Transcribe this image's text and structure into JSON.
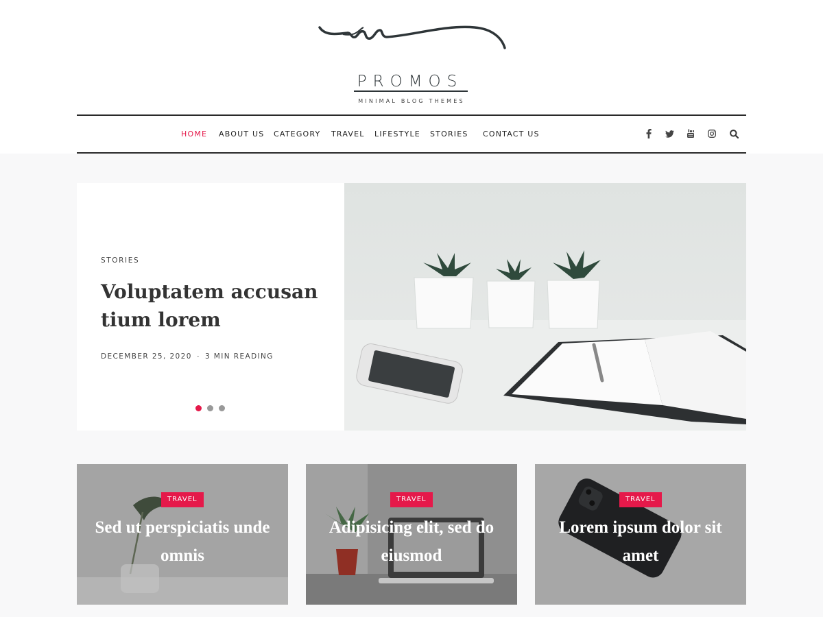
{
  "logo": {
    "wordmark": "PROMOS",
    "tagline": "MINIMAL BLOG THEMES"
  },
  "nav": {
    "items": [
      {
        "label": "HOME",
        "active": true
      },
      {
        "label": "ABOUT US",
        "active": false
      },
      {
        "label": "CATEGORY",
        "active": false
      },
      {
        "label": "TRAVEL",
        "active": false
      },
      {
        "label": "LIFESTYLE",
        "active": false
      },
      {
        "label": "STORIES",
        "active": false
      },
      {
        "label": "CONTACT US",
        "active": false
      }
    ],
    "social_icons": [
      "facebook-icon",
      "twitter-icon",
      "youtube-icon",
      "instagram-icon",
      "search-icon"
    ]
  },
  "hero": {
    "category": "STORIES",
    "title": "Voluptatem accusan tium lorem",
    "date": "DECEMBER 25, 2020",
    "separator": "-",
    "reading": "3 MIN READING",
    "slides": 3,
    "active_slide": 1
  },
  "cards": [
    {
      "category": "TRAVEL",
      "title": "Sed ut perspiciatis unde omnis"
    },
    {
      "category": "TRAVEL",
      "title": "Adipisicing elit, sed do eiusmod"
    },
    {
      "category": "TRAVEL",
      "title": "Lorem ipsum dolor sit amet"
    }
  ],
  "colors": {
    "accent": "#e5194a",
    "text": "#333333",
    "border": "#2a2a2a",
    "background": "#f8f8f9"
  }
}
